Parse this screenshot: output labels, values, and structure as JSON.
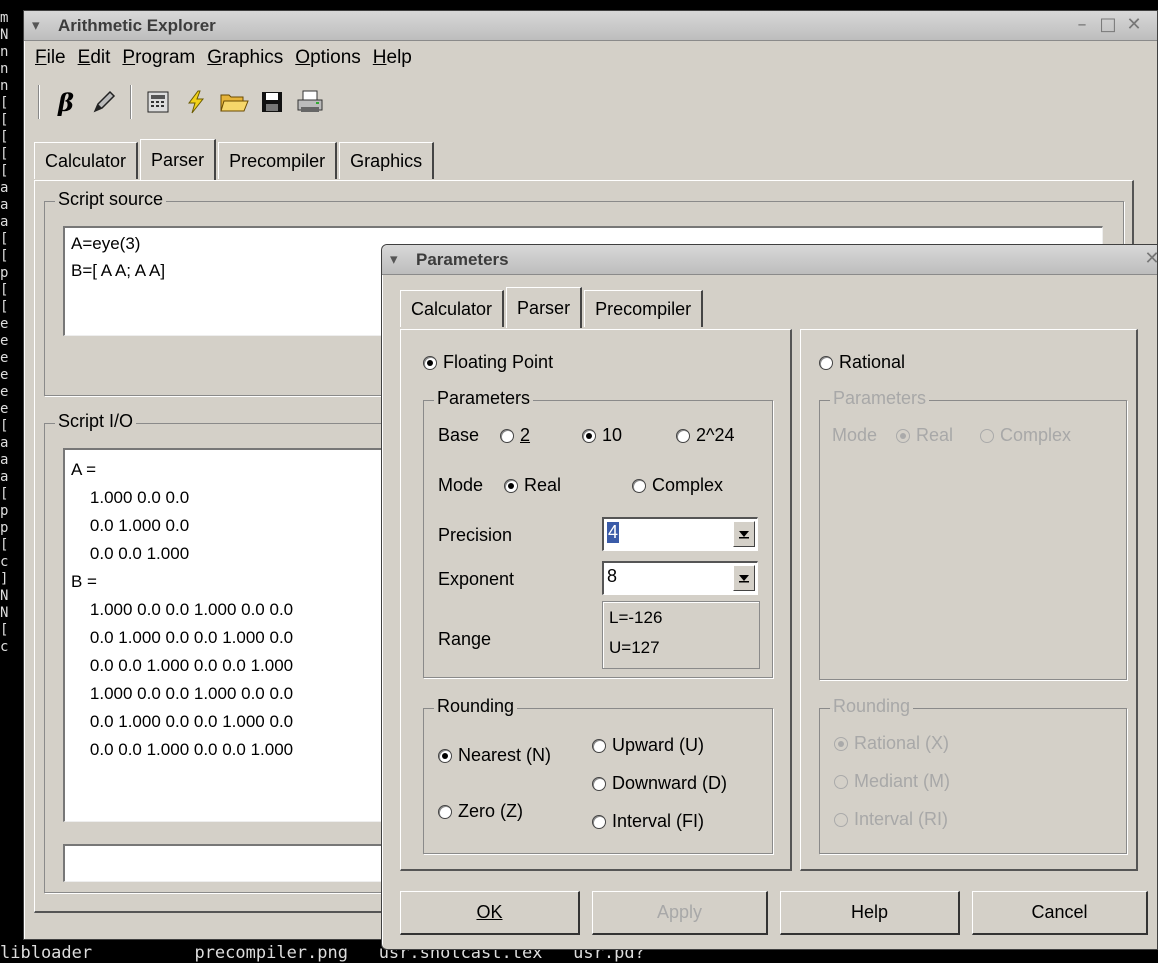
{
  "terminal": {
    "bottom_text": "libloader          precompiler.png   usr.shotcast.tex   usr.pd?"
  },
  "main_window": {
    "title": "Arithmetic Explorer",
    "menu": [
      "File",
      "Edit",
      "Program",
      "Graphics",
      "Options",
      "Help"
    ],
    "toolbar_icons": [
      "beta-icon",
      "pencil-icon",
      "calculator-icon",
      "lightning-icon",
      "open-folder-icon",
      "save-icon",
      "print-icon"
    ],
    "tabs": [
      "Calculator",
      "Parser",
      "Precompiler",
      "Graphics"
    ],
    "active_tab": "Parser",
    "script_source": {
      "label": "Script source",
      "lines": [
        "A=eye(3)",
        "B=[ A A; A A]"
      ]
    },
    "script_io": {
      "label": "Script I/O",
      "lines": [
        "A =",
        "    1.000 0.0 0.0",
        "    0.0 1.000 0.0",
        "    0.0 0.0 1.000",
        "B =",
        "    1.000 0.0 0.0 1.000 0.0 0.0",
        "    0.0 1.000 0.0 0.0 1.000 0.0",
        "    0.0 0.0 1.000 0.0 0.0 1.000",
        "    1.000 0.0 0.0 1.000 0.0 0.0",
        "    0.0 1.000 0.0 0.0 1.000 0.0",
        "    0.0 0.0 1.000 0.0 0.0 1.000"
      ],
      "input_value": ""
    }
  },
  "dialog": {
    "title": "Parameters",
    "tabs": [
      "Calculator",
      "Parser",
      "Precompiler"
    ],
    "active_tab": "Parser",
    "floating": {
      "label": "Floating Point",
      "selected": true,
      "params_label": "Parameters",
      "base_label": "Base",
      "base_options": [
        "2",
        "10",
        "2^24"
      ],
      "base_selected": "10",
      "mode_label": "Mode",
      "mode_options": [
        "Real",
        "Complex"
      ],
      "mode_selected": "Real",
      "precision_label": "Precision",
      "precision_value": "4",
      "exponent_label": "Exponent",
      "exponent_value": "8",
      "range_label": "Range",
      "range_lower": "L=-126",
      "range_upper": "U=127",
      "rounding_label": "Rounding",
      "rounding_nearest": "Nearest (N)",
      "rounding_zero": "Zero (Z)",
      "rounding_upward": "Upward (U)",
      "rounding_downward": "Downward (D)",
      "rounding_interval": "Interval (FI)"
    },
    "rational": {
      "label": "Rational",
      "params_label": "Parameters",
      "mode_label": "Mode",
      "mode_real": "Real",
      "mode_complex": "Complex",
      "rounding_label": "Rounding",
      "rounding_rational": "Rational (X)",
      "rounding_mediant": "Mediant (M)",
      "rounding_interval": "Interval (RI)"
    },
    "buttons": {
      "ok": "OK",
      "apply": "Apply",
      "help": "Help",
      "cancel": "Cancel"
    }
  }
}
